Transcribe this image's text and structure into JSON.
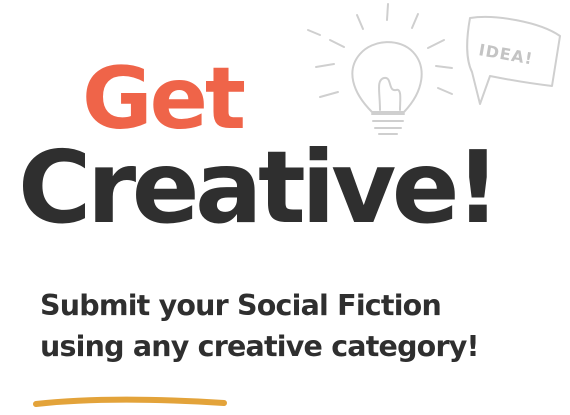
{
  "headline": {
    "line1": "Get",
    "line2": "Creative!"
  },
  "subtitle": {
    "line1": "Submit your Social Fiction",
    "line2": "using any creative category!"
  },
  "illustration": {
    "icon": "lightbulb-icon",
    "bubble_text": "IDEA!"
  },
  "colors": {
    "accent": "#ef6449",
    "text": "#2f2f2f",
    "underline": "#e3a33a",
    "sketch": "#cfcfcf"
  }
}
